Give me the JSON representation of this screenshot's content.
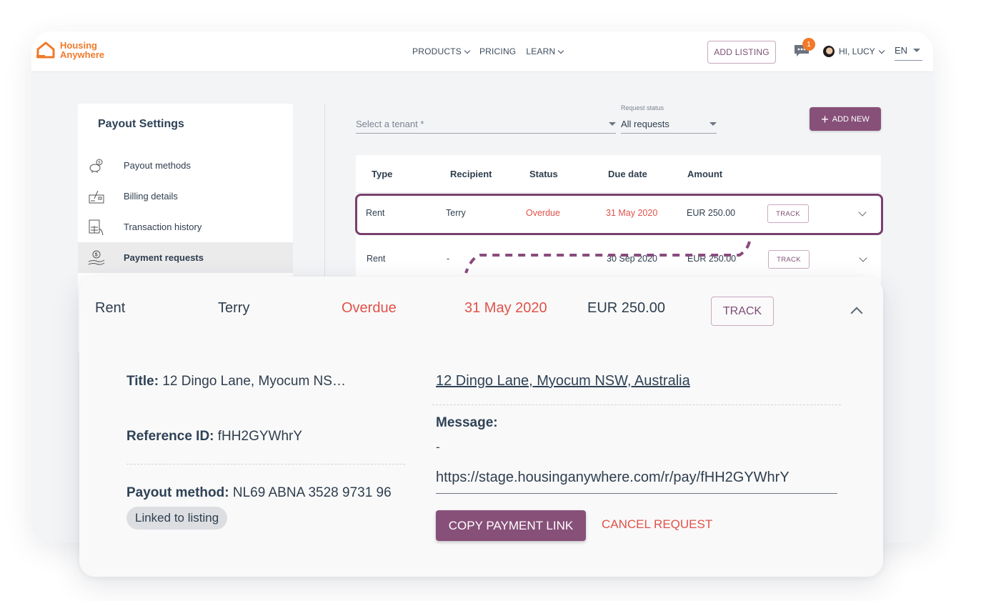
{
  "header": {
    "logo_line1": "Housing",
    "logo_line2": "Anywhere",
    "nav": [
      {
        "label": "PRODUCTS",
        "has_dropdown": true
      },
      {
        "label": "PRICING",
        "has_dropdown": false
      },
      {
        "label": "LEARN",
        "has_dropdown": true
      }
    ],
    "add_listing_label": "ADD LISTING",
    "messages_badge": "1",
    "user_greeting": "HI, LUCY",
    "language": "EN"
  },
  "sidebar": {
    "title": "Payout Settings",
    "items": [
      {
        "label": "Payout methods",
        "icon": "piggy-bank-icon",
        "active": false
      },
      {
        "label": "Billing details",
        "icon": "billing-check-icon",
        "active": false
      },
      {
        "label": "Transaction history",
        "icon": "transaction-receipt-icon",
        "active": false
      },
      {
        "label": "Payment requests",
        "icon": "hand-coin-icon",
        "active": true
      }
    ]
  },
  "filters": {
    "tenant_placeholder": "Select a tenant *",
    "status_label": "Request status",
    "status_value": "All requests",
    "add_new_label": "ADD NEW"
  },
  "table": {
    "headers": [
      "Type",
      "Recipient",
      "Status",
      "Due date",
      "Amount"
    ],
    "rows": [
      {
        "type": "Rent",
        "recipient": "Terry",
        "status": "Overdue",
        "due_date": "31 May 2020",
        "amount": "EUR 250.00",
        "action": "TRACK"
      },
      {
        "type": "Rent",
        "recipient": "-",
        "status": "",
        "due_date": "30 Sep 2020",
        "amount": "EUR 250.00",
        "action": "TRACK"
      }
    ]
  },
  "detail": {
    "type": "Rent",
    "recipient": "Terry",
    "status": "Overdue",
    "due_date": "31 May 2020",
    "amount": "EUR 250.00",
    "track_label": "TRACK",
    "title_label": "Title:",
    "title_value": "12 Dingo Lane, Myocum NS…",
    "reference_label": "Reference ID:",
    "reference_value": "fHH2GYWhrY",
    "payout_label": "Payout method:",
    "payout_value": "NL69 ABNA 3528 9731 96",
    "linked_chip": "Linked to listing",
    "address_link": "12 Dingo Lane, Myocum NSW, Australia",
    "message_label": "Message:",
    "message_value": "-",
    "payment_link": "https://stage.housinganywhere.com/r/pay/fHH2GYWhrY",
    "copy_button": "COPY PAYMENT LINK",
    "cancel_button": "CANCEL REQUEST"
  },
  "colors": {
    "brand_orange": "#f07a2a",
    "accent_purple": "#875079",
    "overdue_red": "#e0524a",
    "text_dark": "#2f3e4e"
  }
}
